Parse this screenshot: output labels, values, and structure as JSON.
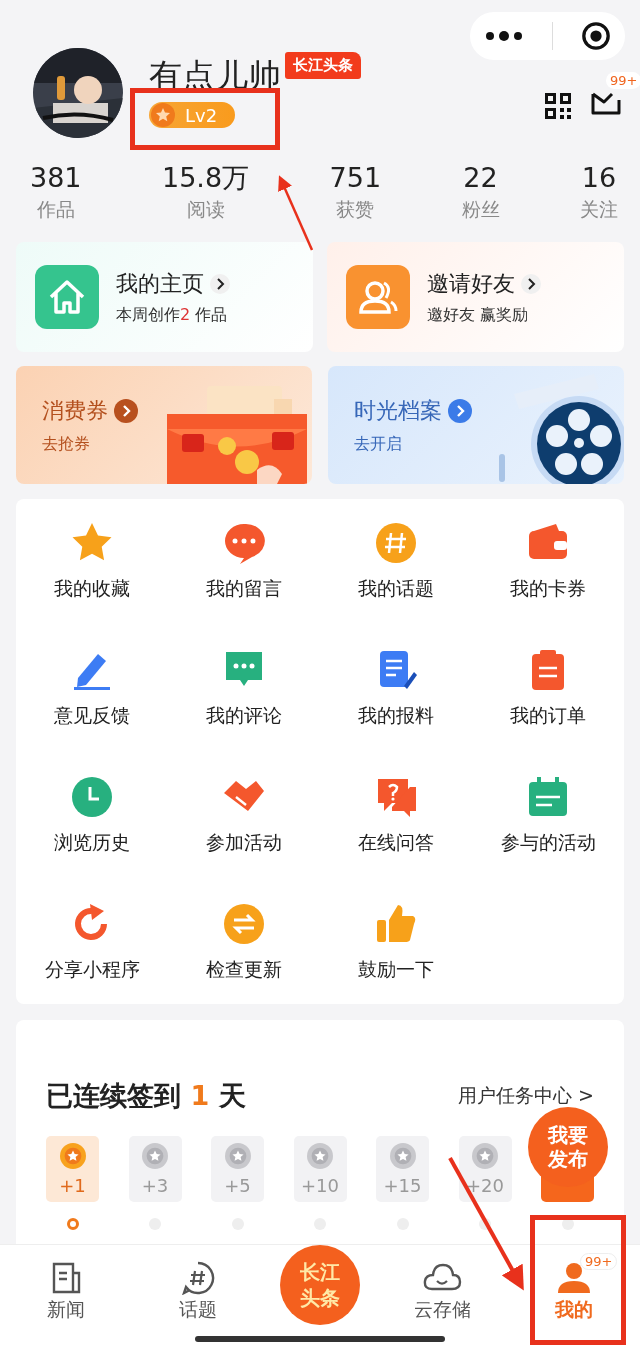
{
  "profile": {
    "name": "有点儿帅",
    "tag": "长江头条",
    "level": "Lv2",
    "mail_badge": "99+"
  },
  "stats": [
    {
      "value": "381",
      "label": "作品"
    },
    {
      "value": "15.8万",
      "label": "阅读"
    },
    {
      "value": "751",
      "label": "获赞"
    },
    {
      "value": "22",
      "label": "粉丝"
    },
    {
      "value": "16",
      "label": "关注"
    }
  ],
  "shortcuts": [
    {
      "kind": "home",
      "title": "我的主页",
      "subtitle": "本周创作",
      "count": "2",
      "suffix": "作品"
    },
    {
      "kind": "invite",
      "title": "邀请好友",
      "subtitle": "邀好友 赢奖励"
    }
  ],
  "banners": [
    {
      "kind": "coupon",
      "title": "消费券",
      "subtitle": "去抢券"
    },
    {
      "kind": "film",
      "title": "时光档案",
      "subtitle": "去开启"
    }
  ],
  "features": [
    {
      "label": "我的收藏"
    },
    {
      "label": "我的留言"
    },
    {
      "label": "我的话题"
    },
    {
      "label": "我的卡券"
    },
    {
      "label": "意见反馈"
    },
    {
      "label": "我的评论"
    },
    {
      "label": "我的报料"
    },
    {
      "label": "我的订单"
    },
    {
      "label": "浏览历史"
    },
    {
      "label": "参加活动"
    },
    {
      "label": "在线问答"
    },
    {
      "label": "参与的活动"
    },
    {
      "label": "分享小程序"
    },
    {
      "label": "检查更新"
    },
    {
      "label": "鼓励一下"
    }
  ],
  "checkin": {
    "title": "已连续签到",
    "count": "1",
    "unit": "天",
    "link": "用户任务中心 >",
    "days": [
      {
        "kind": "normal",
        "label": "+1",
        "selected": true
      },
      {
        "kind": "normal",
        "label": "+3",
        "selected": false
      },
      {
        "kind": "normal",
        "label": "+5",
        "selected": false
      },
      {
        "kind": "normal",
        "label": "+10",
        "selected": false
      },
      {
        "kind": "normal",
        "label": "+15",
        "selected": false
      },
      {
        "kind": "normal",
        "label": "+20",
        "selected": false
      },
      {
        "kind": "bonus",
        "selected": false
      }
    ]
  },
  "fab": {
    "lines": [
      "我要",
      "发布"
    ]
  },
  "tabbar": [
    {
      "kind": "news",
      "label": "新闻",
      "selected": false
    },
    {
      "kind": "topic",
      "label": "话题",
      "selected": false
    },
    {
      "kind": "center",
      "lines": [
        "长江",
        "头条"
      ]
    },
    {
      "kind": "cloud",
      "label": "云存储",
      "selected": false
    },
    {
      "kind": "me",
      "label": "我的",
      "selected": true,
      "badge": "99+"
    }
  ],
  "annotations": [
    {
      "kind": "box"
    },
    {
      "kind": "arrow"
    },
    {
      "kind": "arrow"
    },
    {
      "kind": "box"
    }
  ]
}
